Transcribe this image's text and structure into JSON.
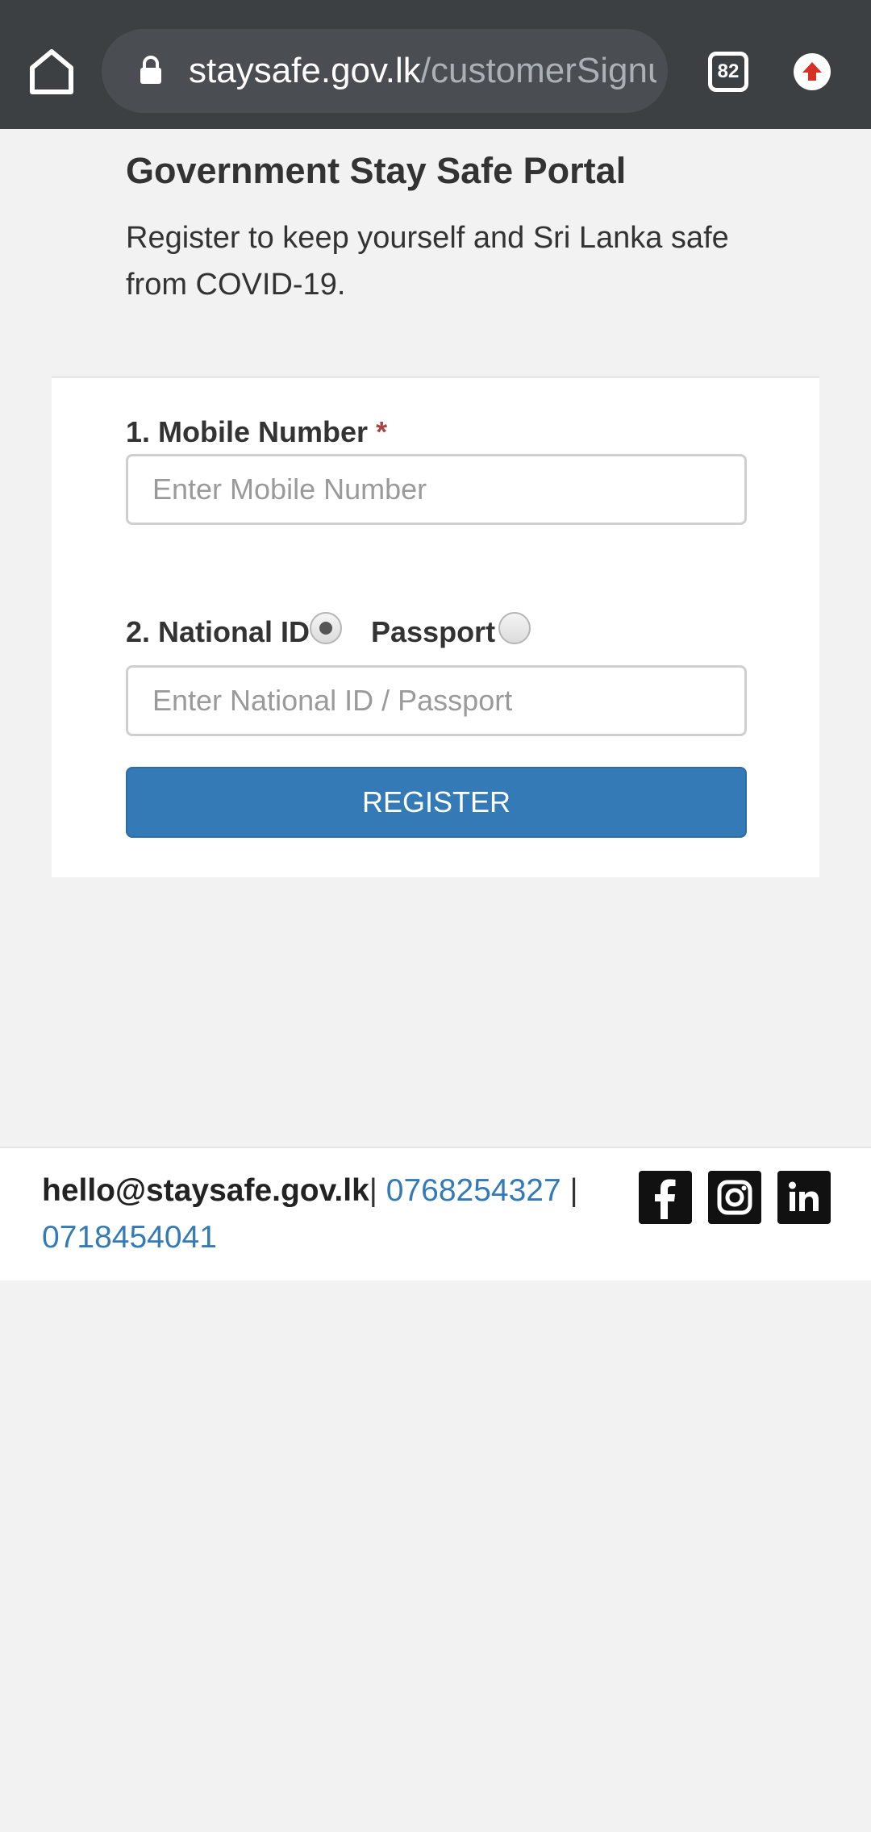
{
  "browser": {
    "url_domain": "staysafe.gov.lk",
    "url_path": "/customerSignup",
    "tab_count": "82"
  },
  "header": {
    "title": "Government Stay Safe Portal",
    "subtitle": "Register to keep yourself and Sri Lanka safe from COVID-19."
  },
  "form": {
    "mobile_label": "1. Mobile Number",
    "required_mark": "*",
    "mobile_placeholder": "Enter Mobile Number",
    "mobile_value": "",
    "id_label": "2. National ID",
    "passport_label": "Passport",
    "id_type_selected": "National ID",
    "id_placeholder": "Enter National ID / Passport",
    "id_value": "",
    "register_label": "REGISTER"
  },
  "footer": {
    "email": "hello@staysafe.gov.lk",
    "separator1": "|",
    "phone1": "0768254327",
    "separator2": "|",
    "phone2": "0718454041",
    "social_icons": [
      "facebook-icon",
      "instagram-icon",
      "linkedin-icon"
    ]
  },
  "colors": {
    "toolbar_bg": "#3c4043",
    "primary_button": "#337ab7",
    "link": "#337ab7",
    "required": "#a94442",
    "page_bg": "#f2f2f2"
  }
}
